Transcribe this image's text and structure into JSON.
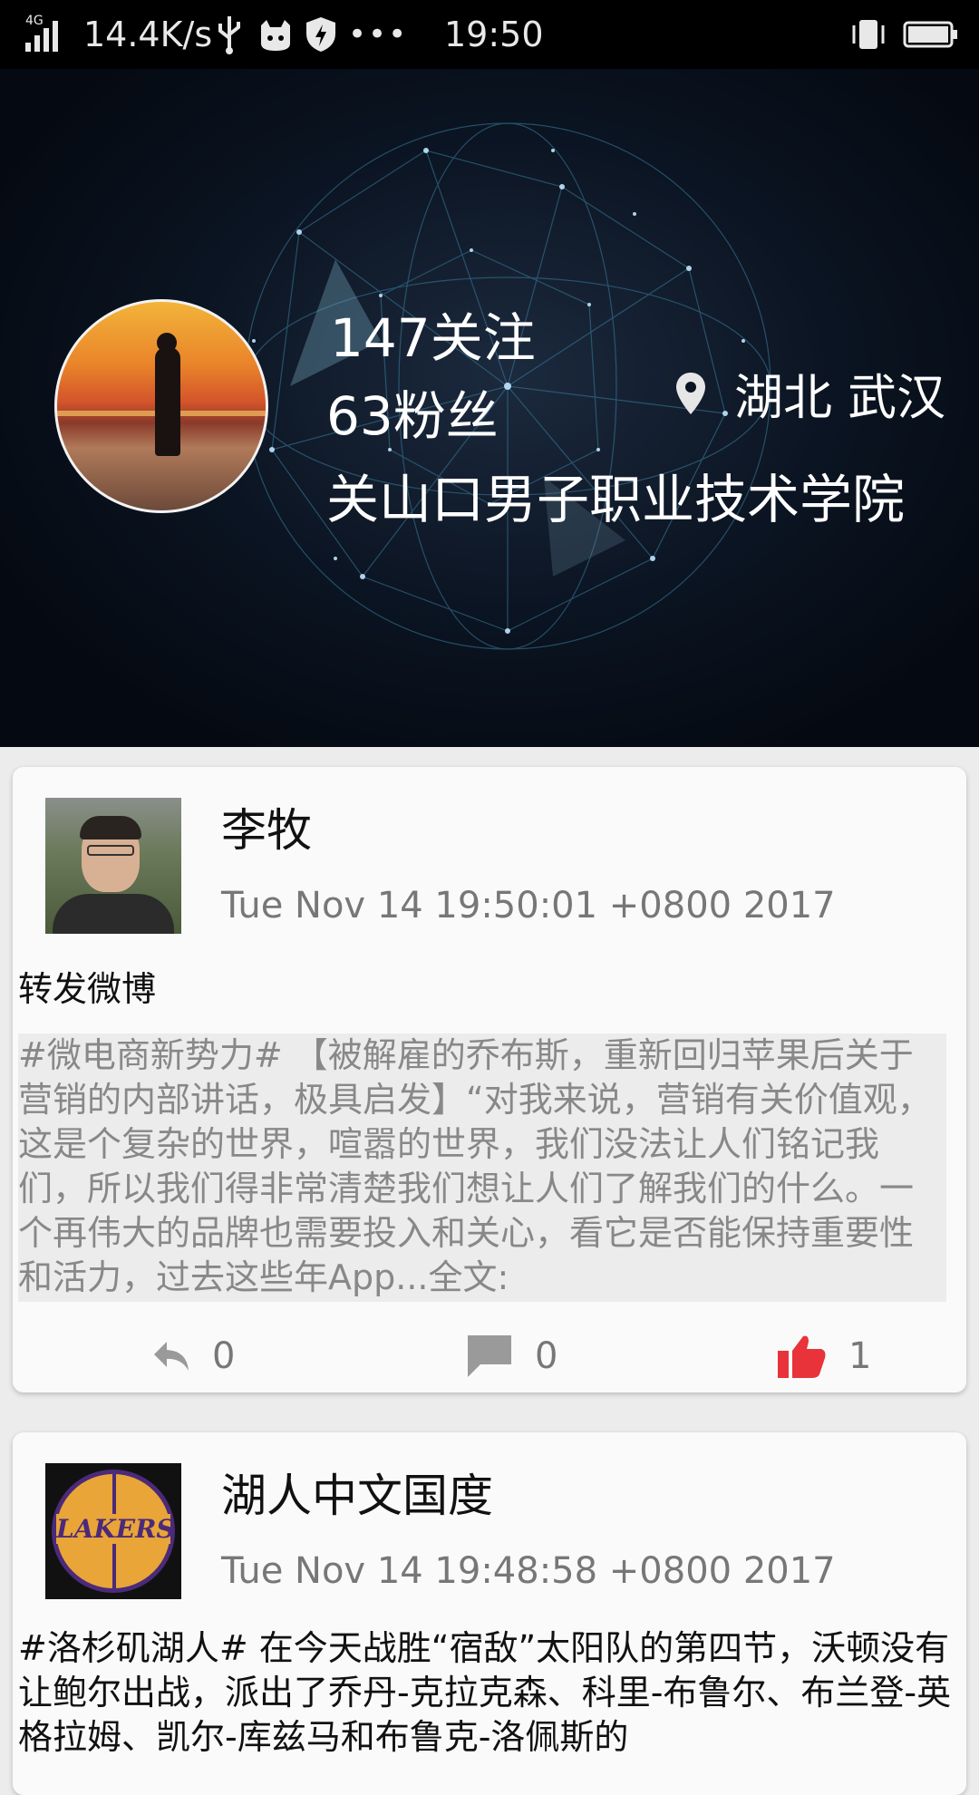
{
  "status_bar": {
    "network_type": "4G",
    "speed": "14.4K/s",
    "more": "•••",
    "time": "19:50",
    "icons": [
      "signal-icon",
      "usb-icon",
      "cat-icon",
      "shield-icon",
      "vibrate-icon",
      "battery-icon"
    ]
  },
  "profile": {
    "following": "147关注",
    "followers": "63粉丝",
    "school": "关山口男子职业技术学院",
    "location": "湖北 武汉"
  },
  "posts": [
    {
      "user": "李牧",
      "time": "Tue Nov 14 19:50:01 +0800 2017",
      "text": "转发微博",
      "quoted": "#微电商新势力# 【被解雇的乔布斯，重新回归苹果后关于营销的内部讲话，极具启发】“对我来说，营销有关价值观，这是个复杂的世界，喧嚣的世界，我们没法让人们铭记我们，所以我们得非常清楚我们想让人们了解我们的什么。一个再伟大的品牌也需要投入和关心，看它是否能保持重要性和活力，过去这些年App...全文:",
      "reposts": "0",
      "comments": "0",
      "likes": "1"
    },
    {
      "user": "湖人中文国度",
      "avatar_text": "LAKERS",
      "time": "Tue Nov 14 19:48:58 +0800 2017",
      "text": "#洛杉矶湖人# 在今天战胜“宿敌”太阳队的第四节，沃顿没有让鲍尔出战，派出了乔丹-克拉克森、科里-布鲁尔、布兰登-英格拉姆、凯尔-库兹马和布鲁克-洛佩斯的"
    }
  ],
  "colors": {
    "like_active": "#e8333a",
    "action_gray": "#9a9a9a",
    "header_bg": "#0b1422"
  }
}
